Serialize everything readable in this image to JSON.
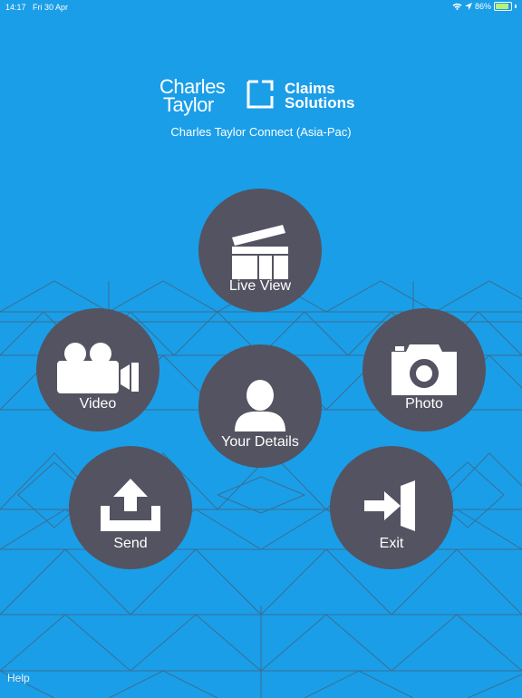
{
  "status_bar": {
    "time": "14:17",
    "date": "Fri 30 Apr",
    "battery": "86%",
    "battery_level": 0.86,
    "icons": [
      "wifi-icon",
      "location-arrow-icon",
      "battery-charging-icon"
    ]
  },
  "logo": {
    "line1": "Charles",
    "line2": "Taylor",
    "right_line1": "Claims",
    "right_line2": "Solutions"
  },
  "subtitle": "Charles Taylor Connect (Asia-Pac)",
  "buttons": {
    "live_view": "Live View",
    "video": "Video",
    "your_details": "Your Details",
    "photo": "Photo",
    "send": "Send",
    "exit": "Exit"
  },
  "footer": {
    "help": "Help"
  },
  "colors": {
    "background": "#1a9ee8",
    "button": "#545361",
    "text": "#ffffff"
  }
}
